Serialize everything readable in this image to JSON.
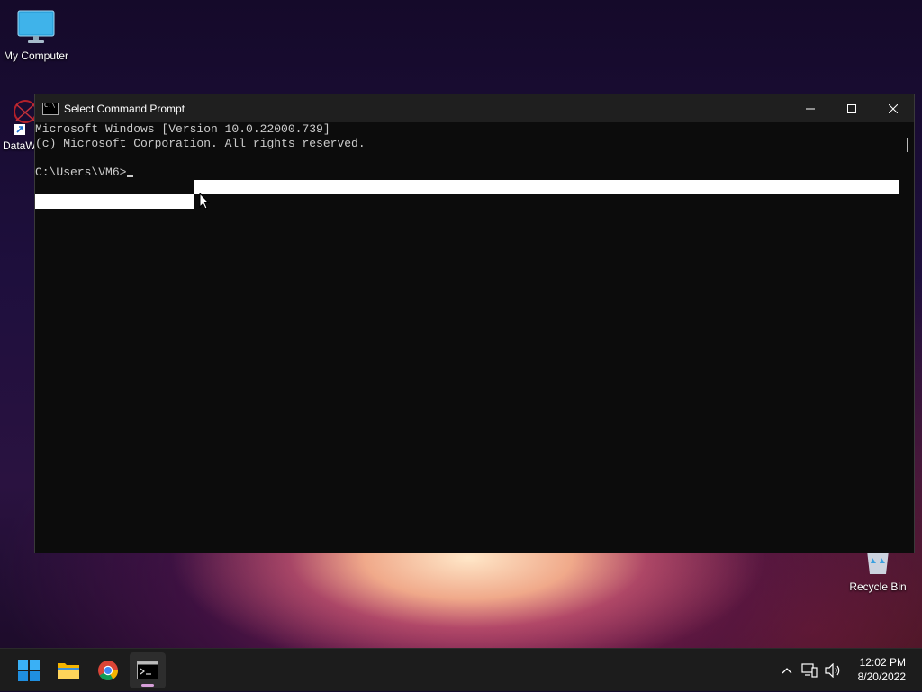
{
  "desktop": {
    "icons": [
      {
        "label": "My Computer",
        "icon": "monitor-icon"
      },
      {
        "label": "DataW",
        "icon": "shortcut-app-icon"
      },
      {
        "label": "Recycle Bin",
        "icon": "recycle-bin-icon"
      }
    ]
  },
  "window": {
    "title": "Select Command Prompt",
    "icon": "cmd-icon",
    "controls": {
      "minimize": "minimize-icon",
      "maximize": "maximize-icon",
      "close": "close-icon"
    }
  },
  "console": {
    "lines": [
      "Microsoft Windows [Version 10.0.22000.739]",
      "(c) Microsoft Corporation. All rights reserved.",
      "",
      "C:\\Users\\VM6>"
    ],
    "selection_color": "#ffffff",
    "background_color": "#0c0c0c",
    "text_color": "#cccccc"
  },
  "taskbar": {
    "apps": [
      {
        "name": "Start",
        "icon": "windows-start-icon"
      },
      {
        "name": "File Explorer",
        "icon": "folder-icon"
      },
      {
        "name": "Google Chrome",
        "icon": "chrome-icon"
      },
      {
        "name": "Command Prompt",
        "icon": "cmd-icon",
        "active": true
      }
    ],
    "tray": {
      "icons": [
        "chevron-up-icon",
        "network-icon",
        "volume-icon"
      ]
    },
    "clock": {
      "time": "12:02 PM",
      "date": "8/20/2022"
    }
  }
}
